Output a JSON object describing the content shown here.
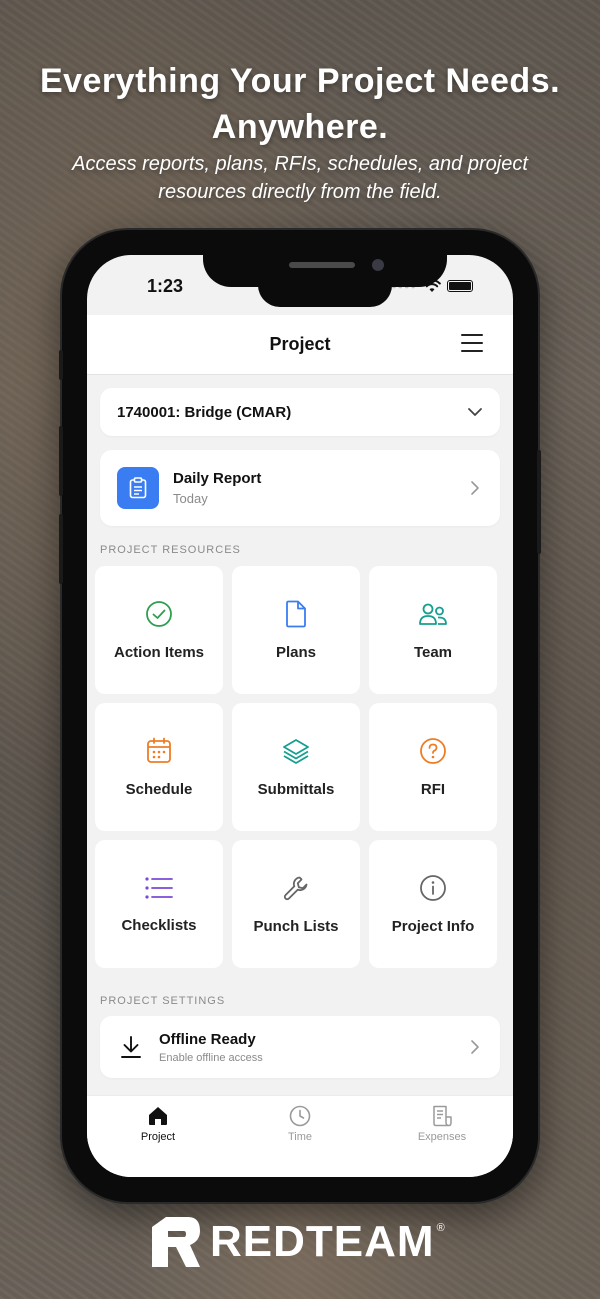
{
  "promo": {
    "headline_line1": "Everything Your Project Needs.",
    "headline_line2": "Anywhere.",
    "subhead": "Access reports, plans, RFIs, schedules, and project resources directly from the field."
  },
  "status_bar": {
    "time": "1:23"
  },
  "header": {
    "title": "Project",
    "menu_icon": "hamburger-icon"
  },
  "project_selector": {
    "value": "1740001: Bridge (CMAR)",
    "icon": "chevron-down-icon"
  },
  "daily_report": {
    "title": "Daily Report",
    "subtitle": "Today",
    "icon": "clipboard-icon",
    "icon_color": "#3a7df2"
  },
  "resources": {
    "section_label": "PROJECT RESOURCES",
    "items": [
      {
        "label": "Action Items",
        "icon": "check-circle-icon",
        "color": "#2e9e4f"
      },
      {
        "label": "Plans",
        "icon": "document-icon",
        "color": "#3a7df2"
      },
      {
        "label": "Team",
        "icon": "users-icon",
        "color": "#169f8f"
      },
      {
        "label": "Schedule",
        "icon": "calendar-icon",
        "color": "#ee7d24"
      },
      {
        "label": "Submittals",
        "icon": "layers-icon",
        "color": "#169f8f"
      },
      {
        "label": "RFI",
        "icon": "question-circle-icon",
        "color": "#ee7d24"
      },
      {
        "label": "Checklists",
        "icon": "list-icon",
        "color": "#7b4bd6"
      },
      {
        "label": "Punch Lists",
        "icon": "wrench-icon",
        "color": "#666666"
      },
      {
        "label": "Project Info",
        "icon": "info-circle-icon",
        "color": "#666666"
      }
    ]
  },
  "settings": {
    "section_label": "PROJECT SETTINGS",
    "offline_title": "Offline Ready",
    "offline_subtitle": "Enable offline access",
    "offline_icon": "download-icon"
  },
  "tabbar": {
    "tabs": [
      {
        "label": "Project",
        "icon": "home-icon",
        "active": true
      },
      {
        "label": "Time",
        "icon": "clock-icon",
        "active": false
      },
      {
        "label": "Expenses",
        "icon": "receipt-icon",
        "active": false
      }
    ]
  },
  "brand": {
    "logo_text": "REDTEAM",
    "registered": "®"
  }
}
